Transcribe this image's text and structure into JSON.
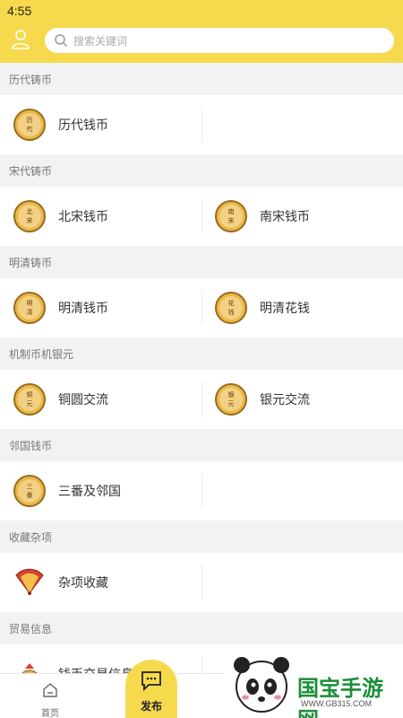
{
  "status_bar": {
    "time": "4:55"
  },
  "search": {
    "placeholder": "搜索关键词"
  },
  "sections": [
    {
      "title": "历代铸币",
      "items": [
        {
          "label": "历代钱币",
          "icon": "coin-icon",
          "coin_text": "历\n代"
        }
      ]
    },
    {
      "title": "宋代铸币",
      "items": [
        {
          "label": "北宋钱币",
          "icon": "coin-icon",
          "coin_text": "北\n宋"
        },
        {
          "label": "南宋钱币",
          "icon": "coin-icon",
          "coin_text": "南\n宋"
        }
      ]
    },
    {
      "title": "明清铸币",
      "items": [
        {
          "label": "明清钱币",
          "icon": "coin-icon",
          "coin_text": "明\n清"
        },
        {
          "label": "明清花钱",
          "icon": "coin-icon",
          "coin_text": "花\n钱"
        }
      ]
    },
    {
      "title": "机制币机银元",
      "items": [
        {
          "label": "铜圆交流",
          "icon": "coin-icon",
          "coin_text": "铜\n元"
        },
        {
          "label": "银元交流",
          "icon": "coin-icon",
          "coin_text": "银\n元"
        }
      ]
    },
    {
      "title": "邻国钱币",
      "items": [
        {
          "label": "三番及邻国",
          "icon": "coin-icon",
          "coin_text": "三\n番"
        }
      ]
    },
    {
      "title": "收藏杂项",
      "items": [
        {
          "label": "杂项收藏",
          "icon": "fan-icon"
        }
      ]
    },
    {
      "title": "贸易信息",
      "items": [
        {
          "label": "钱币交易信息",
          "icon": "money-bag-icon"
        }
      ]
    }
  ],
  "tabbar": {
    "home_label": "首页",
    "publish_label": "发布"
  },
  "watermark": {
    "brand": "国宝手游网",
    "url": "WWW.GB315.COM"
  },
  "colors": {
    "header": "#f7d94d",
    "coin": "#e8b84a",
    "coin_border": "#9a6b1c",
    "brand_green": "#1c8e3a"
  }
}
